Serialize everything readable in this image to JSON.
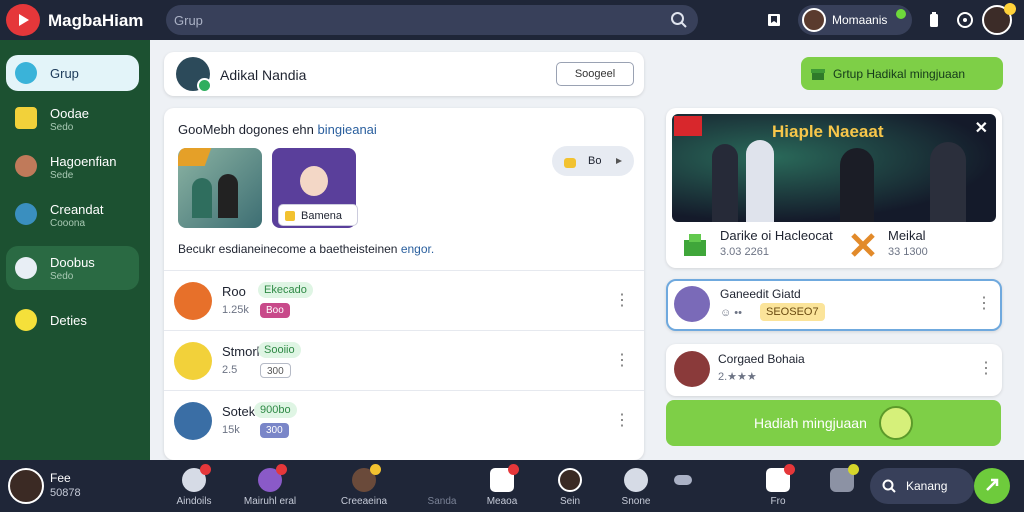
{
  "app": {
    "title": "MagbaHiam"
  },
  "search": {
    "placeholder": "Grup"
  },
  "topbar": {
    "user_name": "Momaanis"
  },
  "sidebar": {
    "items": [
      {
        "label": "Grup",
        "sub": ""
      },
      {
        "label": "Oodae",
        "sub": "Sedo"
      },
      {
        "label": "Hagoenfian",
        "sub": "Sede"
      },
      {
        "label": "Creandat",
        "sub": "Cooona"
      },
      {
        "label": "Doobus",
        "sub": "Sedo"
      },
      {
        "label": "Deties",
        "sub": ""
      }
    ]
  },
  "header_card": {
    "title": "Adikal Nandia",
    "report_label": "Soogeel"
  },
  "action_button": {
    "label": "Grtup Hadikal mingjuaan"
  },
  "feed": {
    "heading": "GooMebh dogones ehn",
    "heading_accent": "bingieanai",
    "thumb_chip": "Bamena",
    "react_label": "Bo",
    "text": "Becukr esdianeinecome a baetheisteinen",
    "text_accent": "engor.",
    "rows": [
      {
        "name": "Roo",
        "tag": "Ekecado",
        "meta": "1.25k",
        "chip": "Boo"
      },
      {
        "name": "Stmork",
        "tag": "Sooiio",
        "meta": "2.5",
        "chip": "300"
      },
      {
        "name": "Sotek",
        "tag": "900bo",
        "meta": "15k",
        "chip": "300"
      }
    ]
  },
  "event_card": {
    "title": "Hiaple Naeaat",
    "items": [
      {
        "name": "Darike oi Hacleocat",
        "meta": "3.03 2261"
      },
      {
        "name": "Meikal",
        "meta": "33 1300"
      }
    ]
  },
  "side_cards": [
    {
      "name": "Ganeedit Giatd",
      "chip": "SEOSEO7"
    },
    {
      "name": "Corgaed Bohaia",
      "meta": "2.★★★"
    }
  ],
  "green_button": {
    "label": "Hadiah mingjuaan"
  },
  "bottombar": {
    "me_name": "Fee",
    "me_sub": "50878",
    "nav": [
      {
        "label": "Aindoils"
      },
      {
        "label": "Mairuhl eral"
      },
      {
        "label": "Creeaeina"
      },
      {
        "label": "Sanda"
      },
      {
        "label": "Meaoa"
      },
      {
        "label": "Sein"
      },
      {
        "label": "Snone"
      },
      {
        "label": ""
      },
      {
        "label": "Fro"
      }
    ],
    "search_label": "Kanang"
  },
  "colors": {
    "accent_green": "#7ecf47",
    "sidebar_bg": "#1c5131",
    "topbar_bg": "#1f2638",
    "brand_red": "#e5373a"
  }
}
